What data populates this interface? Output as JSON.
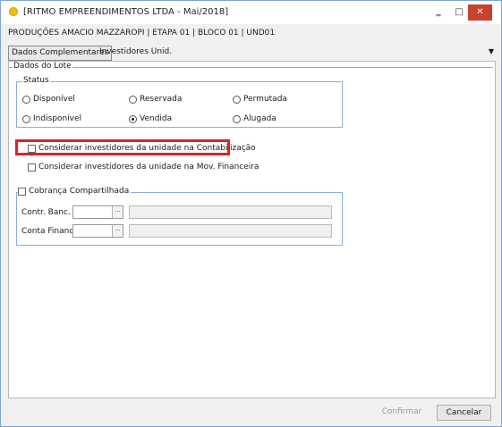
{
  "window": {
    "title": "[RITMO EMPREENDIMENTOS LTDA - Mai/2018]",
    "minimize_glyph": "‗",
    "maximize_glyph": "□",
    "close_glyph": "✕"
  },
  "breadcrumb": "PRODUÇÕES AMACIO MAZZAROPI | ETAPA 01 | BLOCO 01 | UND01",
  "tabs": {
    "items": [
      {
        "label": "Dados Complementares"
      },
      {
        "label": "Investidores Unid."
      }
    ],
    "dropdown_glyph": "▼"
  },
  "lote": {
    "legend": "Dados do Lote",
    "status": {
      "legend": "Status",
      "options": [
        {
          "label": "Disponível",
          "checked": false
        },
        {
          "label": "Reservada",
          "checked": false
        },
        {
          "label": "Permutada",
          "checked": false
        },
        {
          "label": "Indisponível",
          "checked": false
        },
        {
          "label": "Vendida",
          "checked": true
        },
        {
          "label": "Alugada",
          "checked": false
        }
      ]
    },
    "checkbox_contabilizacao": {
      "label": "Considerar investidores da unidade na Contabilização",
      "checked": false
    },
    "checkbox_mov_financeira": {
      "label": "Considerar investidores da unidade na Mov. Financeira",
      "checked": false
    },
    "cobranca": {
      "legend": "Cobrança Compartilhada",
      "checked": false,
      "contr_banc_label": "Contr. Banc.",
      "conta_financ_label": "Conta Financ.",
      "lookup_glyph": "..."
    }
  },
  "buttons": {
    "confirm": "Confirmar",
    "cancel": "Cancelar"
  },
  "colors": {
    "highlight": "#e02020",
    "close_button": "#c9412f",
    "group_border": "#8ab0d8"
  }
}
